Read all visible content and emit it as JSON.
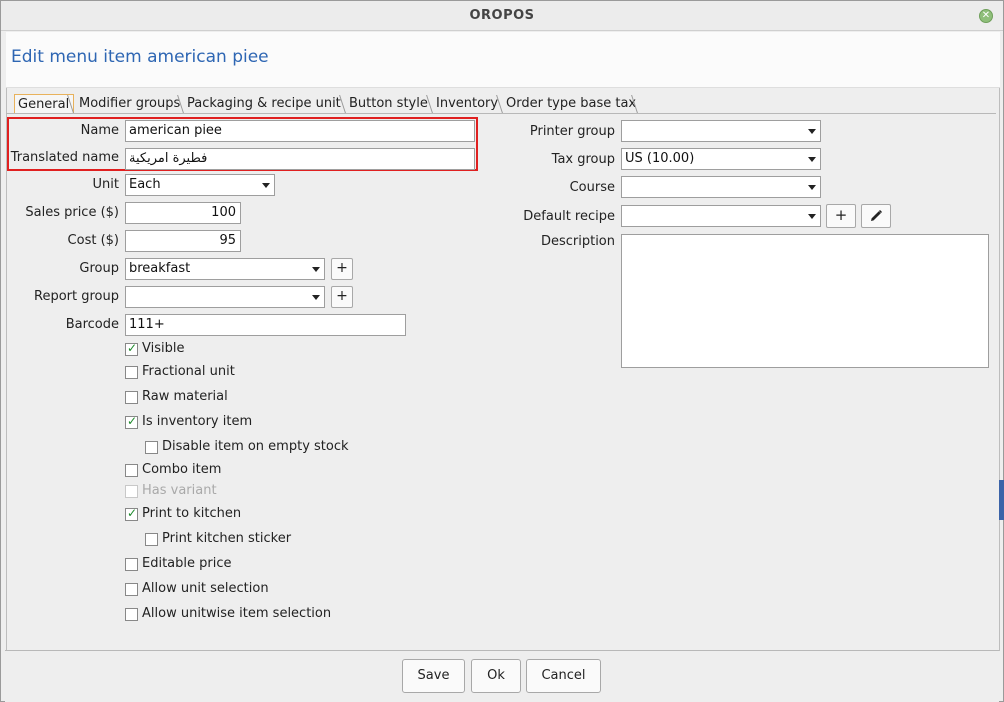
{
  "window": {
    "title": "OROPOS"
  },
  "header": {
    "title": "Edit menu item american piee"
  },
  "tabs": [
    {
      "label": "General",
      "active": true
    },
    {
      "label": "Modifier groups"
    },
    {
      "label": "Packaging & recipe unit"
    },
    {
      "label": "Button style"
    },
    {
      "label": "Inventory"
    },
    {
      "label": "Order type base tax"
    }
  ],
  "form": {
    "name": {
      "label": "Name",
      "value": "american piee"
    },
    "translated_name": {
      "label": "Translated name",
      "value": "فطيرة امريكية"
    },
    "unit": {
      "label": "Unit",
      "value": "Each"
    },
    "sales_price": {
      "label": "Sales price ($)",
      "value": "100"
    },
    "cost": {
      "label": "Cost ($)",
      "value": "95"
    },
    "group": {
      "label": "Group",
      "value": "breakfast"
    },
    "report_group": {
      "label": "Report group",
      "value": ""
    },
    "barcode": {
      "label": "Barcode",
      "value": "111+"
    },
    "printer_group": {
      "label": "Printer group",
      "value": ""
    },
    "tax_group": {
      "label": "Tax group",
      "value": "US (10.00)"
    },
    "course": {
      "label": "Course",
      "value": ""
    },
    "default_recipe": {
      "label": "Default recipe",
      "value": ""
    },
    "description": {
      "label": "Description",
      "value": ""
    }
  },
  "checkboxes": [
    {
      "label": "Visible",
      "checked": true
    },
    {
      "label": "Fractional unit",
      "checked": false
    },
    {
      "label": "Raw material",
      "checked": false
    },
    {
      "label": "Is inventory item",
      "checked": true
    },
    {
      "label": "Disable item on empty stock",
      "checked": false
    },
    {
      "label": "Combo item",
      "checked": false
    },
    {
      "label": "Has variant",
      "checked": false,
      "disabled": true
    },
    {
      "label": "Print to kitchen",
      "checked": true
    },
    {
      "label": "Print kitchen sticker",
      "checked": false
    },
    {
      "label": "Editable price",
      "checked": false
    },
    {
      "label": "Allow unit selection",
      "checked": false
    },
    {
      "label": "Allow unitwise item selection",
      "checked": false
    }
  ],
  "buttons": {
    "save": "Save",
    "ok": "Ok",
    "cancel": "Cancel",
    "plus": "+",
    "edit_icon": "pencil-icon"
  }
}
